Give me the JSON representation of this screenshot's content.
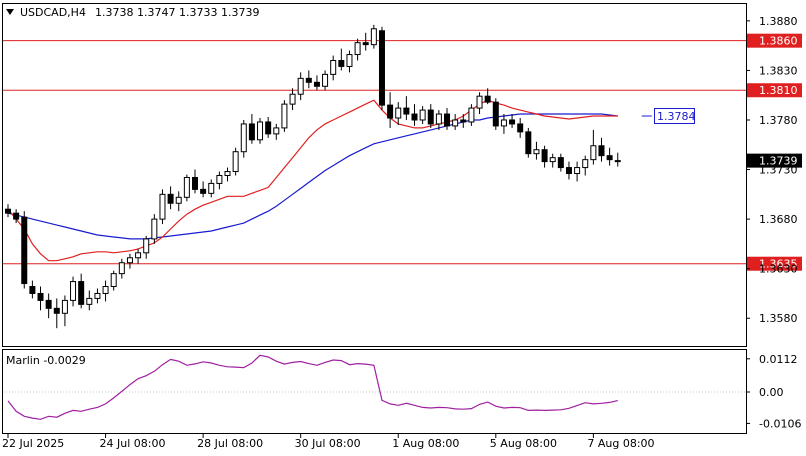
{
  "header": {
    "symbol": "USDCAD,H4",
    "ohlc": "1.3738 1.3747 1.3733 1.3739"
  },
  "indicator": {
    "label": "Marlin -0.0029"
  },
  "colors": {
    "candle": "#000000",
    "level_line": "#e02020",
    "ma_fast": "#e02020",
    "ma_slow": "#1a1ad0",
    "oscillator": "#a020a0",
    "current_price_bg": "#000000",
    "target_label_border": "#1a1ad0"
  },
  "chart_data": [
    {
      "type": "candlestick",
      "title": "USDCAD,H4",
      "y_ticks": [
        "1.3880",
        "1.3830",
        "1.3780",
        "1.3730",
        "1.3680",
        "1.3630",
        "1.3580"
      ],
      "ylim": [
        1.3552,
        1.3897
      ],
      "x_ticks": [
        {
          "index": 0,
          "label": "22 Jul 2025"
        },
        {
          "index": 12,
          "label": "24 Jul 08:00"
        },
        {
          "index": 24,
          "label": "28 Jul 08:00"
        },
        {
          "index": 36,
          "label": "30 Jul 08:00"
        },
        {
          "index": 48,
          "label": "1 Aug 08:00"
        },
        {
          "index": 60,
          "label": "5 Aug 08:00"
        },
        {
          "index": 72,
          "label": "7 Aug 08:00"
        }
      ],
      "levels": [
        {
          "value": 1.386,
          "label": "1.3860"
        },
        {
          "value": 1.381,
          "label": "1.3810"
        },
        {
          "value": 1.3635,
          "label": "1.3635"
        }
      ],
      "target_label": {
        "value": 1.3784,
        "label": "1.3784"
      },
      "current_price": {
        "value": 1.3739,
        "label": "1.3739"
      },
      "candles": [
        [
          1.369,
          1.3695,
          1.3682,
          1.3686
        ],
        [
          1.3686,
          1.369,
          1.3676,
          1.368
        ],
        [
          1.3682,
          1.3688,
          1.361,
          1.3615
        ],
        [
          1.3612,
          1.3618,
          1.36,
          1.3605
        ],
        [
          1.3605,
          1.3612,
          1.3588,
          1.3598
        ],
        [
          1.3598,
          1.3605,
          1.358,
          1.359
        ],
        [
          1.359,
          1.36,
          1.357,
          1.3585
        ],
        [
          1.3585,
          1.3603,
          1.3572,
          1.3598
        ],
        [
          1.3598,
          1.3622,
          1.3592,
          1.3617
        ],
        [
          1.3617,
          1.3625,
          1.359,
          1.3594
        ],
        [
          1.3594,
          1.3608,
          1.3588,
          1.36
        ],
        [
          1.36,
          1.361,
          1.3595,
          1.3605
        ],
        [
          1.3605,
          1.3618,
          1.3597,
          1.3612
        ],
        [
          1.3612,
          1.3628,
          1.3608,
          1.3625
        ],
        [
          1.3625,
          1.364,
          1.362,
          1.3636
        ],
        [
          1.3636,
          1.3645,
          1.363,
          1.3641
        ],
        [
          1.3641,
          1.365,
          1.3635,
          1.3646
        ],
        [
          1.3646,
          1.3663,
          1.364,
          1.366
        ],
        [
          1.366,
          1.3685,
          1.3655,
          1.368
        ],
        [
          1.368,
          1.371,
          1.3675,
          1.3705
        ],
        [
          1.3705,
          1.3713,
          1.369,
          1.3696
        ],
        [
          1.3696,
          1.3708,
          1.3688,
          1.3702
        ],
        [
          1.3702,
          1.3725,
          1.3698,
          1.3722
        ],
        [
          1.3722,
          1.373,
          1.3706,
          1.371
        ],
        [
          1.371,
          1.3718,
          1.3702,
          1.3706
        ],
        [
          1.3706,
          1.372,
          1.3702,
          1.3716
        ],
        [
          1.3716,
          1.3728,
          1.371,
          1.3724
        ],
        [
          1.3724,
          1.3732,
          1.3718,
          1.3728
        ],
        [
          1.3728,
          1.3752,
          1.3724,
          1.3748
        ],
        [
          1.3748,
          1.378,
          1.3742,
          1.3776
        ],
        [
          1.3776,
          1.3786,
          1.3756,
          1.376
        ],
        [
          1.376,
          1.3782,
          1.3756,
          1.3778
        ],
        [
          1.3778,
          1.3783,
          1.3762,
          1.3766
        ],
        [
          1.3766,
          1.3776,
          1.376,
          1.3772
        ],
        [
          1.3772,
          1.38,
          1.3768,
          1.3796
        ],
        [
          1.3796,
          1.3812,
          1.379,
          1.3806
        ],
        [
          1.3806,
          1.3828,
          1.38,
          1.3822
        ],
        [
          1.3822,
          1.383,
          1.3812,
          1.3818
        ],
        [
          1.3818,
          1.3825,
          1.381,
          1.3814
        ],
        [
          1.3814,
          1.383,
          1.381,
          1.3826
        ],
        [
          1.3826,
          1.3845,
          1.382,
          1.384
        ],
        [
          1.384,
          1.3852,
          1.383,
          1.3834
        ],
        [
          1.3834,
          1.385,
          1.3828,
          1.3846
        ],
        [
          1.3846,
          1.3862,
          1.384,
          1.3858
        ],
        [
          1.3858,
          1.3868,
          1.385,
          1.3856
        ],
        [
          1.3856,
          1.3876,
          1.3852,
          1.3872
        ],
        [
          1.387,
          1.3874,
          1.379,
          1.3795
        ],
        [
          1.3795,
          1.3808,
          1.3772,
          1.3782
        ],
        [
          1.3782,
          1.3798,
          1.3775,
          1.3792
        ],
        [
          1.3792,
          1.3804,
          1.378,
          1.3786
        ],
        [
          1.3786,
          1.3796,
          1.3774,
          1.378
        ],
        [
          1.378,
          1.3794,
          1.3776,
          1.379
        ],
        [
          1.379,
          1.3796,
          1.3772,
          1.3776
        ],
        [
          1.3776,
          1.379,
          1.377,
          1.3786
        ],
        [
          1.3786,
          1.3792,
          1.377,
          1.3774
        ],
        [
          1.3774,
          1.3786,
          1.377,
          1.378
        ],
        [
          1.378,
          1.3786,
          1.3772,
          1.3778
        ],
        [
          1.3778,
          1.3796,
          1.3774,
          1.3792
        ],
        [
          1.3792,
          1.3808,
          1.3786,
          1.3804
        ],
        [
          1.3804,
          1.3812,
          1.3796,
          1.3798
        ],
        [
          1.3798,
          1.3802,
          1.377,
          1.3774
        ],
        [
          1.3774,
          1.3786,
          1.3766,
          1.378
        ],
        [
          1.378,
          1.3786,
          1.3772,
          1.3776
        ],
        [
          1.3776,
          1.3782,
          1.3762,
          1.3768
        ],
        [
          1.3768,
          1.3772,
          1.3742,
          1.3746
        ],
        [
          1.3746,
          1.3758,
          1.374,
          1.375
        ],
        [
          1.375,
          1.3754,
          1.3732,
          1.3738
        ],
        [
          1.3738,
          1.3746,
          1.3732,
          1.3742
        ],
        [
          1.3742,
          1.3746,
          1.3728,
          1.3732
        ],
        [
          1.3732,
          1.3738,
          1.372,
          1.3726
        ],
        [
          1.3726,
          1.3738,
          1.3718,
          1.3732
        ],
        [
          1.3732,
          1.3744,
          1.3724,
          1.374
        ],
        [
          1.374,
          1.377,
          1.3735,
          1.3754
        ],
        [
          1.3754,
          1.3762,
          1.3738,
          1.3744
        ],
        [
          1.3744,
          1.3752,
          1.3734,
          1.374
        ],
        [
          1.3738,
          1.3747,
          1.3733,
          1.3739
        ]
      ],
      "ma_fast": [
        1.369,
        1.368,
        1.367,
        1.3655,
        1.3645,
        1.3638,
        1.3638,
        1.364,
        1.3642,
        1.3645,
        1.3646,
        1.3647,
        1.3647,
        1.3646,
        1.3647,
        1.3648,
        1.365,
        1.3653,
        1.3656,
        1.3662,
        1.367,
        1.3678,
        1.3685,
        1.369,
        1.3694,
        1.3697,
        1.37,
        1.3703,
        1.3703,
        1.3703,
        1.3706,
        1.3709,
        1.3712,
        1.3722,
        1.3732,
        1.3742,
        1.3752,
        1.3762,
        1.377,
        1.3776,
        1.378,
        1.3784,
        1.3788,
        1.3792,
        1.3796,
        1.38,
        1.379,
        1.3782,
        1.3776,
        1.3774,
        1.3772,
        1.3772,
        1.3774,
        1.3776,
        1.3778,
        1.378,
        1.3784,
        1.379,
        1.3796,
        1.38,
        1.3797,
        1.3795,
        1.3792,
        1.379,
        1.3788,
        1.3786,
        1.3784,
        1.3783,
        1.3782,
        1.3781,
        1.3782,
        1.3783,
        1.3784,
        1.3784,
        1.3784,
        1.3784
      ],
      "ma_slow": [
        1.3686,
        1.3684,
        1.3682,
        1.368,
        1.3678,
        1.3676,
        1.3674,
        1.3672,
        1.367,
        1.3668,
        1.3666,
        1.3664,
        1.3663,
        1.3662,
        1.3661,
        1.366,
        1.366,
        1.366,
        1.3661,
        1.3662,
        1.3663,
        1.3664,
        1.3665,
        1.3666,
        1.3667,
        1.3668,
        1.367,
        1.3672,
        1.3674,
        1.3676,
        1.368,
        1.3684,
        1.3688,
        1.3693,
        1.3699,
        1.3705,
        1.3711,
        1.3717,
        1.3723,
        1.3729,
        1.3734,
        1.3739,
        1.3744,
        1.3748,
        1.3752,
        1.3756,
        1.3758,
        1.376,
        1.3762,
        1.3764,
        1.3766,
        1.3768,
        1.377,
        1.3772,
        1.3774,
        1.3776,
        1.3778,
        1.378,
        1.378,
        1.3782,
        1.3783,
        1.3784,
        1.3785,
        1.3786,
        1.3786,
        1.3786,
        1.3786,
        1.3786,
        1.3786,
        1.3786,
        1.3786,
        1.3786,
        1.3786,
        1.3786,
        1.3785,
        1.3784
      ]
    },
    {
      "type": "line",
      "title": "Marlin -0.0029",
      "y_ticks": [
        "0.0112",
        "0.00",
        "-0.0106"
      ],
      "ylim": [
        -0.0135,
        0.0135
      ],
      "series": [
        {
          "name": "Marlin",
          "values": [
            -0.003,
            -0.0065,
            -0.0082,
            -0.0088,
            -0.0092,
            -0.0082,
            -0.0085,
            -0.0072,
            -0.0062,
            -0.0065,
            -0.0058,
            -0.0052,
            -0.004,
            -0.002,
            0.0002,
            0.0025,
            0.0045,
            0.0055,
            0.007,
            0.0092,
            0.011,
            0.0104,
            0.009,
            0.0095,
            0.0102,
            0.0098,
            0.009,
            0.0085,
            0.0084,
            0.0082,
            0.0098,
            0.0124,
            0.0118,
            0.0104,
            0.0094,
            0.01,
            0.0103,
            0.0096,
            0.009,
            0.01,
            0.0108,
            0.0106,
            0.0092,
            0.0096,
            0.0094,
            0.009,
            -0.0028,
            -0.004,
            -0.0045,
            -0.0038,
            -0.0045,
            -0.0052,
            -0.0054,
            -0.0052,
            -0.0053,
            -0.0057,
            -0.0058,
            -0.0056,
            -0.0042,
            -0.0034,
            -0.0048,
            -0.0054,
            -0.0052,
            -0.0053,
            -0.0062,
            -0.0061,
            -0.0062,
            -0.0061,
            -0.006,
            -0.0055,
            -0.0046,
            -0.0036,
            -0.004,
            -0.0038,
            -0.0035,
            -0.0029
          ]
        }
      ]
    }
  ]
}
